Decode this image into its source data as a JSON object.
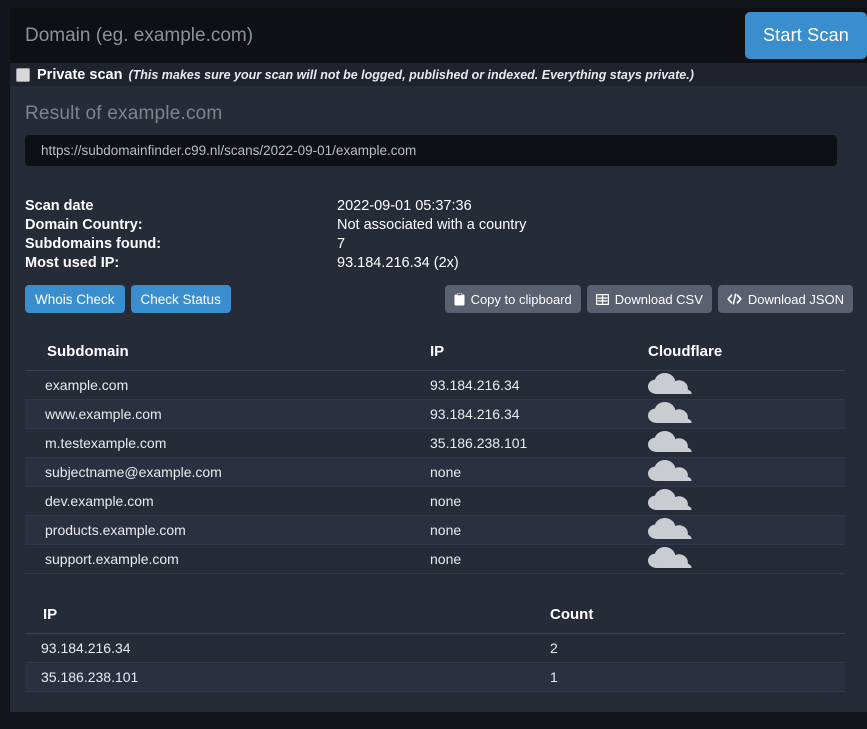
{
  "search": {
    "placeholder": "Domain (eg. example.com)",
    "value": "",
    "start_scan_label": "Start Scan"
  },
  "private_scan": {
    "label": "Private scan",
    "note": "(This makes sure your scan will not be logged, published or indexed. Everything stays private.)",
    "checked": false
  },
  "result": {
    "title": "Result of example.com",
    "url": "https://subdomainfinder.c99.nl/scans/2022-09-01/example.com",
    "info": [
      {
        "key": "Scan date",
        "value": "2022-09-01 05:37:36"
      },
      {
        "key": "Domain Country:",
        "value": "Not associated with a country"
      },
      {
        "key": "Subdomains found:",
        "value": "7"
      },
      {
        "key": "Most used IP:",
        "value": "93.184.216.34 (2x)"
      }
    ]
  },
  "actions": {
    "left": [
      {
        "label": "Whois Check"
      },
      {
        "label": "Check Status"
      }
    ],
    "right": [
      {
        "label": "Copy to clipboard",
        "icon": "clipboard-icon"
      },
      {
        "label": "Download CSV",
        "icon": "table-icon"
      },
      {
        "label": "Download JSON",
        "icon": "code-icon"
      }
    ]
  },
  "subdomain_table": {
    "columns": [
      "Subdomain",
      "IP",
      "Cloudflare"
    ],
    "rows": [
      {
        "subdomain": "example.com",
        "ip": "93.184.216.34",
        "cloudflare": "cloud-icon"
      },
      {
        "subdomain": "www.example.com",
        "ip": "93.184.216.34",
        "cloudflare": "cloud-icon"
      },
      {
        "subdomain": "m.testexample.com",
        "ip": "35.186.238.101",
        "cloudflare": "cloud-icon"
      },
      {
        "subdomain": "subjectname@example.com",
        "ip": "none",
        "cloudflare": "cloud-icon"
      },
      {
        "subdomain": "dev.example.com",
        "ip": "none",
        "cloudflare": "cloud-icon"
      },
      {
        "subdomain": "products.example.com",
        "ip": "none",
        "cloudflare": "cloud-icon"
      },
      {
        "subdomain": "support.example.com",
        "ip": "none",
        "cloudflare": "cloud-icon"
      }
    ]
  },
  "ip_count_table": {
    "columns": [
      "IP",
      "Count"
    ],
    "rows": [
      {
        "ip": "93.184.216.34",
        "count": "2"
      },
      {
        "ip": "35.186.238.101",
        "count": "1"
      }
    ]
  },
  "colors": {
    "accent_blue": "#3a8ecd",
    "panel_bg": "#262b38",
    "page_bg": "#14161d",
    "row_alt": "#2b3040",
    "grey_button": "#5a6070",
    "cloud_grey": "#c9ccd1"
  }
}
